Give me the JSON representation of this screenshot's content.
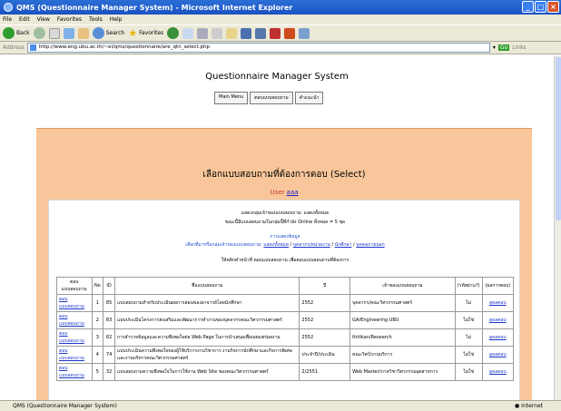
{
  "window": {
    "title": "QMS (Questionnaire Manager System) - Microsoft Internet Explorer"
  },
  "menu": [
    "File",
    "Edit",
    "View",
    "Favorites",
    "Tools",
    "Help"
  ],
  "toolbar": {
    "back": "Back",
    "search": "Search",
    "favorites": "Favorites"
  },
  "address": {
    "label": "Address",
    "url": "http://www.eng.ubu.ac.th/~ei/qms/questionnaire/are_qtn_select.php",
    "go": "Go",
    "links": "Links"
  },
  "page": {
    "app_title": "Questionnaire Manager System",
    "nav": [
      "Main Menu",
      "ตอบแบบสอบถาม",
      "คำแนะนำ"
    ],
    "heading": "เลือกแบบสอบถามที่ต้องการตอบ (Select)",
    "user_label": "User",
    "user_name": "aaa",
    "info_line1": "แสดงกลุ่มเจ้าของแบบสอบถาม: แสดงทั้งหมด",
    "info_line2": "ขณะนี้มีแบบสอบถามในกลุ่มนี้ที่กำลัง Online ทั้งหมด = 5 ชุด",
    "filter_title": "การแสดงข้อมูล",
    "filter_label": "เลือกที่มาหรือกลุ่มเจ้าของแบบสอบถาม:",
    "filter_links": [
      "แสดงทั้งหมด",
      "บุคลากร/หน่วยงาน",
      "นักศึกษา",
      "บุคคลภายนอก"
    ],
    "instruction": "ให้คลิกคำหน้าที่ ตอบแบบสอบถาม เพื่อตอบแบบสอบถามที่ต้องการ",
    "columns": [
      "ตอบแบบสอบถาม",
      "No",
      "ID",
      "ชื่อแบบสอบถาม",
      "ปี",
      "เจ้าของแบบสอบถาม",
      "(รหัสผ่าน?)",
      "(ผลการตอบ)"
    ],
    "rows": [
      {
        "action": "ตอบแบบสอบถาม",
        "no": "1",
        "id": "85",
        "name": "แบบสอบถามสำหรับประเมินผลการสอนของอาจารย์โดยนักศึกษา",
        "year": "2552",
        "owner": "บุคลากร/คณะวิศวกรรมศาสตร์",
        "pw": "ไม่",
        "result": "ดูผลตอบ"
      },
      {
        "action": "ตอบแบบสอบถาม",
        "no": "2",
        "id": "83",
        "name": "แบบประเมินโครงการส่งเสริมและพัฒนาการทำงานของบุคลากรคณะวิศวกรรมศาสตร์",
        "year": "2552",
        "owner": "GA/Engineering UBU",
        "pw": "ไม่ใช่",
        "result": "ดูผลตอบ"
      },
      {
        "action": "ตอบแบบสอบถาม",
        "no": "3",
        "id": "82",
        "name": "การสำรวจข้อมูลและความพึงพอใจต่อ Web Page ในการนำเสนอเพื่อเผยแพร่ผลงาน",
        "year": "2552",
        "owner": "thitikan/Research",
        "pw": "ไม่",
        "result": "ดูผลตอบ"
      },
      {
        "action": "ตอบแบบสอบถาม",
        "no": "4",
        "id": "74",
        "name": "แบบประเมินความพึงพอใจของผู้ใช้บริการงานวิชาการ งานกิจการนักศึกษาและกิจการพิเศษ และงานบริหารคณะวิศวกรรมศาสตร์",
        "year": "ประจำปี/ประเมิน",
        "owner": "คณะวิศว์/งานบริการ",
        "pw": "ไม่ใช่",
        "result": "ดูผลตอบ"
      },
      {
        "action": "ตอบแบบสอบถาม",
        "no": "5",
        "id": "32",
        "name": "แบบสอบถามความพึงพอใจในการใช้งาน Web Site ของคณะวิศวกรรมศาสตร์",
        "year": "2/2551",
        "owner": "Web Master/ภาควิชาวิศวกรรมอุตสาหการ",
        "pw": "ไม่ใช่",
        "result": "ดูผลตอบ"
      }
    ]
  },
  "status": {
    "text": "QMS (Questionnaire Manager System)",
    "zone": "Internet"
  }
}
